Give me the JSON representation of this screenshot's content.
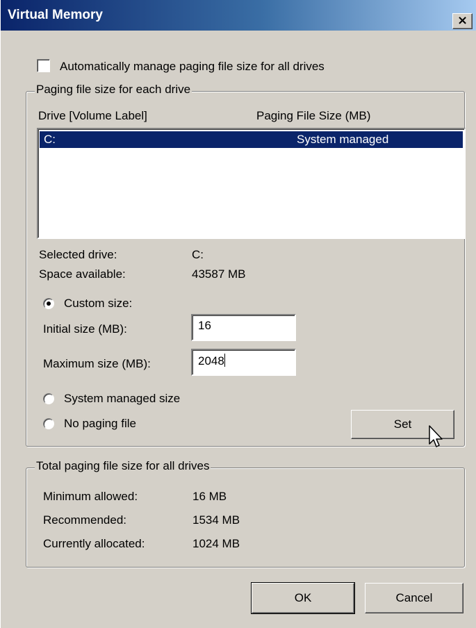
{
  "window": {
    "title": "Virtual Memory",
    "close_glyph": "×"
  },
  "auto_manage": {
    "label": "Automatically manage paging file size for all drives",
    "checked": false
  },
  "paging_group": {
    "title": "Paging file size for each drive",
    "col_drive": "Drive  [Volume Label]",
    "col_size": "Paging File Size (MB)",
    "rows": [
      {
        "drive": "C:",
        "size": "System managed",
        "selected": true
      }
    ],
    "selected_drive_label": "Selected drive:",
    "selected_drive_value": "C:",
    "space_label": "Space available:",
    "space_value": "43587 MB",
    "custom_size_label": "Custom size:",
    "initial_label": "Initial size (MB):",
    "initial_value": "16",
    "maximum_label": "Maximum size (MB):",
    "maximum_value": "2048",
    "system_managed_label": "System managed size",
    "no_paging_label": "No paging file",
    "selected_option": "custom",
    "set_label": "Set"
  },
  "total_group": {
    "title": "Total paging file size for all drives",
    "min_label": "Minimum allowed:",
    "min_value": "16 MB",
    "rec_label": "Recommended:",
    "rec_value": "1534 MB",
    "cur_label": "Currently allocated:",
    "cur_value": "1024 MB"
  },
  "buttons": {
    "ok": "OK",
    "cancel": "Cancel"
  },
  "colors": {
    "face": "#d4d0c8",
    "title_start": "#0a246a",
    "title_end": "#a6caf0",
    "selection": "#0a246a"
  },
  "icons": {
    "close": "close-icon",
    "cursor": "arrow-cursor-icon"
  }
}
